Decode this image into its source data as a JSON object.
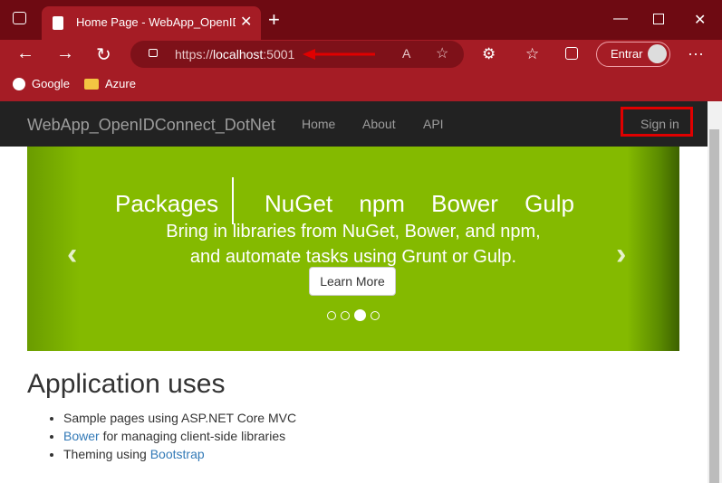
{
  "browser": {
    "tab_title": "Home Page - WebApp_OpenIDConnect_DotNet",
    "url_prefix": "https://",
    "url_host": "localhost",
    "url_port": ":5001",
    "profile_label": "Entrar",
    "bookmarks": [
      "Google",
      "Azure"
    ]
  },
  "site": {
    "brand": "WebApp_OpenIDConnect_DotNet",
    "nav": [
      "Home",
      "About",
      "API"
    ],
    "signin": "Sign in"
  },
  "carousel": {
    "title": "Packages",
    "words": "NuGet npm Bower Gulp",
    "text_line1": "Bring in libraries from NuGet, Bower, and npm,",
    "text_line2": "and automate tasks using Grunt or Gulp.",
    "button": "Learn More",
    "active_slide": 3,
    "slide_count": 4
  },
  "main": {
    "heading": "Application uses",
    "item1": "Sample pages using ASP.NET Core MVC",
    "item2_link": "Bower",
    "item2_text": " for managing client-side libraries",
    "item3_text": "Theming using ",
    "item3_link": "Bootstrap"
  },
  "colors": {
    "chrome": "#a51c25",
    "navbar": "#222222",
    "carousel": "#84ba00",
    "link": "#337ab7",
    "annotation": "#e00000"
  }
}
